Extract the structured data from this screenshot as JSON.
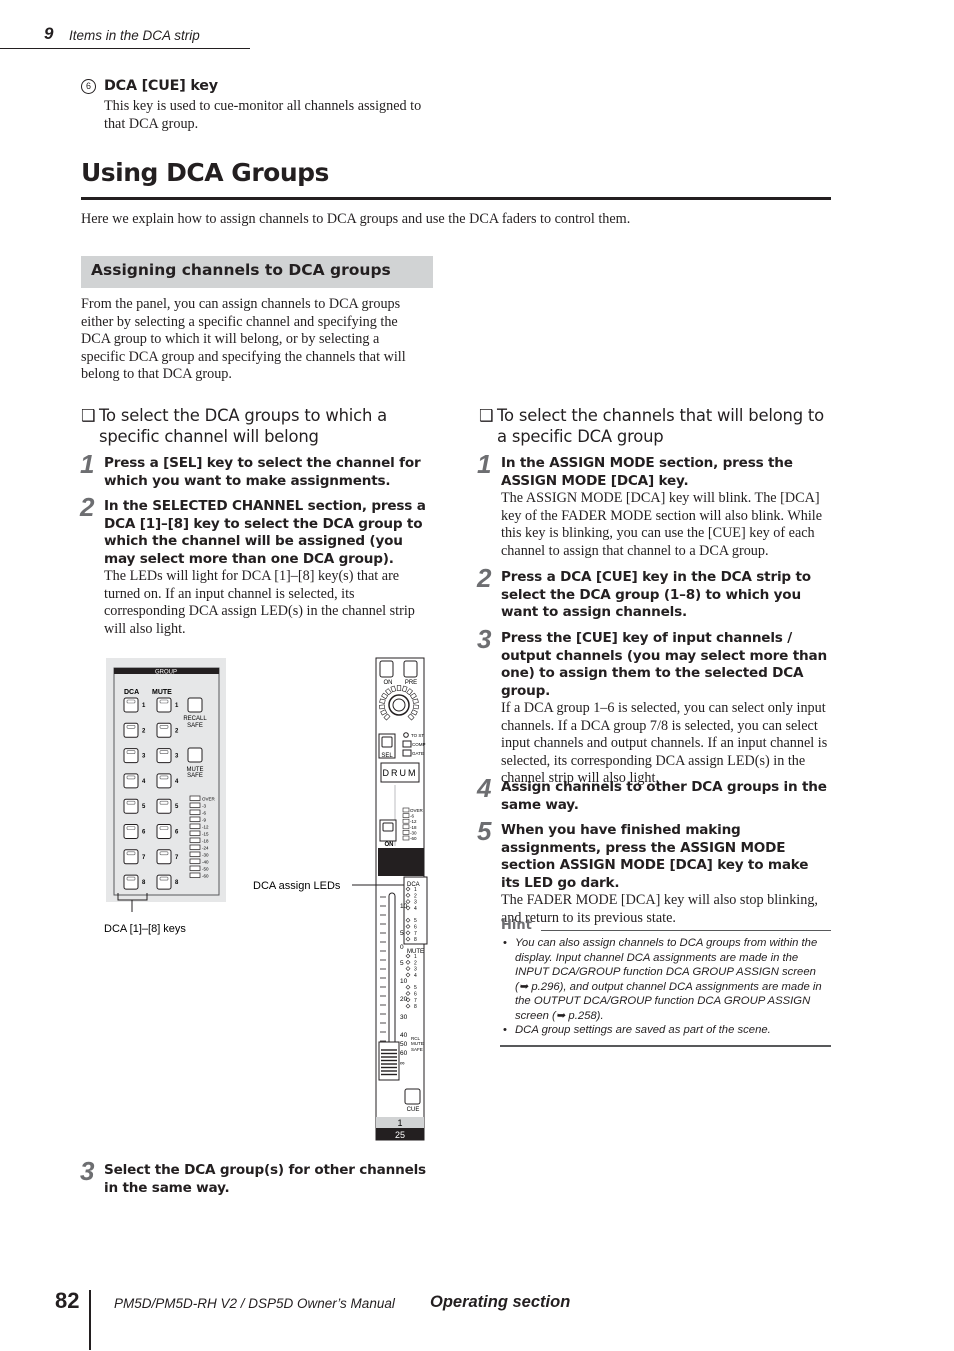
{
  "header": {
    "chapter_number": "9",
    "chapter_title": "Items in the DCA strip"
  },
  "item6": {
    "marker": "6",
    "title": "DCA [CUE] key",
    "text": "This key is used to cue-monitor all channels assigned to that DCA group."
  },
  "section": {
    "title": "Using DCA Groups",
    "intro": "Here we explain how to assign channels to DCA groups and use the DCA faders to control them."
  },
  "subsection": {
    "title": "Assigning channels to DCA groups",
    "text": "From the panel, you can assign channels to DCA groups either by selecting a specific channel and specifying the DCA group to which it will belong, or by selecting a specific DCA group and specifying the channels that will belong to that DCA group."
  },
  "left": {
    "heading": "To select the DCA groups to which a specific channel will belong",
    "steps": [
      {
        "num": "1",
        "head": "Press a [SEL] key to select the channel for which you want to make assignments.",
        "text": ""
      },
      {
        "num": "2",
        "head": "In the SELECTED CHANNEL section, press a DCA [1]–[8] key to select the DCA group to which the channel will be assigned (you may select more than one DCA group).",
        "text": "The LEDs will light for DCA [1]–[8] key(s) that are turned on. If an input channel is selected, its corresponding DCA assign LED(s) in the channel strip will also light."
      },
      {
        "num": "3",
        "head": "Select the DCA group(s) for other channels in the same way.",
        "text": ""
      }
    ]
  },
  "right": {
    "heading": "To select the channels that will belong to a specific DCA group",
    "steps": [
      {
        "num": "1",
        "head": "In the ASSIGN MODE section, press the ASSIGN MODE [DCA] key.",
        "text": "The ASSIGN MODE [DCA] key will blink. The [DCA] key of the FADER MODE section will also blink. While this key is blinking, you can use the [CUE] key of each channel to assign that channel to a DCA group."
      },
      {
        "num": "2",
        "head": "Press a DCA [CUE] key in the DCA strip to select the DCA group (1–8) to which you want to assign channels.",
        "text": ""
      },
      {
        "num": "3",
        "head": "Press the [CUE] key of input channels / output channels (you may select more than one) to assign them to the selected DCA group.",
        "text": "If a DCA group 1–6 is selected, you can select only input channels. If a DCA group 7/8 is selected, you can select input channels and output channels. If an input channel is selected, its corresponding DCA assign LED(s) in the channel strip will also light."
      },
      {
        "num": "4",
        "head": "Assign channels to other DCA groups in the same way.",
        "text": ""
      },
      {
        "num": "5",
        "head": "When you have finished making assignments, press the ASSIGN MODE section ASSIGN MODE [DCA] key to make its LED go dark.",
        "text": "The FADER MODE [DCA] key will also stop blinking, and return to its previous state."
      }
    ]
  },
  "hint": {
    "label": "Hint",
    "items": [
      "You can also assign channels to DCA groups from within the display. Input channel DCA assignments are made in the INPUT DCA/GROUP function DCA GROUP ASSIGN screen (➥ p.296), and output channel DCA assignments are made in the OUTPUT DCA/GROUP function DCA GROUP ASSIGN screen (➥ p.258).",
      "DCA group settings are saved as part of the scene."
    ]
  },
  "figure_group": {
    "title": "GROUP",
    "dca_label": "DCA",
    "mute_label": "MUTE",
    "recall_safe": [
      "RECALL",
      "SAFE"
    ],
    "mute_safe": [
      "MUTE",
      "SAFE"
    ],
    "key_numbers": [
      "1",
      "2",
      "3",
      "4",
      "5",
      "6",
      "7",
      "8"
    ],
    "meter_labels": [
      "OVER",
      "-3",
      "-6",
      "-9",
      "-12",
      "-15",
      "-18",
      "-24",
      "-30",
      "-40",
      "-50",
      "-60"
    ],
    "callout": "DCA [1]–[8] keys"
  },
  "figure_strip": {
    "on_label": "ON",
    "pre_label": "PRE",
    "sel_label": "SEL",
    "to_st": "TO ST",
    "comp": "COMP",
    "gate": "GATE",
    "name": "DRUM",
    "meter_labels": [
      "OVER",
      "-6",
      "-12",
      "-18",
      "-30",
      "-60"
    ],
    "on2_label": "ON",
    "dca_label": "DCA",
    "mute_label": "MUTE",
    "led_numbers": [
      "1",
      "2",
      "3",
      "4",
      "5",
      "6",
      "7",
      "8"
    ],
    "scale": [
      "10",
      "5",
      "0",
      "5",
      "10",
      "20",
      "30",
      "40",
      "50",
      "60",
      "∞"
    ],
    "rcl_safe": [
      "RCL",
      "MUTE",
      "SAFE"
    ],
    "cue_label": "CUE",
    "channel_number": "1",
    "bottom_number": "25",
    "callout": "DCA assign LEDs"
  },
  "footer": {
    "page_number": "82",
    "manual": "PM5D/PM5D-RH V2 / DSP5D Owner’s Manual",
    "section": "Operating section"
  }
}
